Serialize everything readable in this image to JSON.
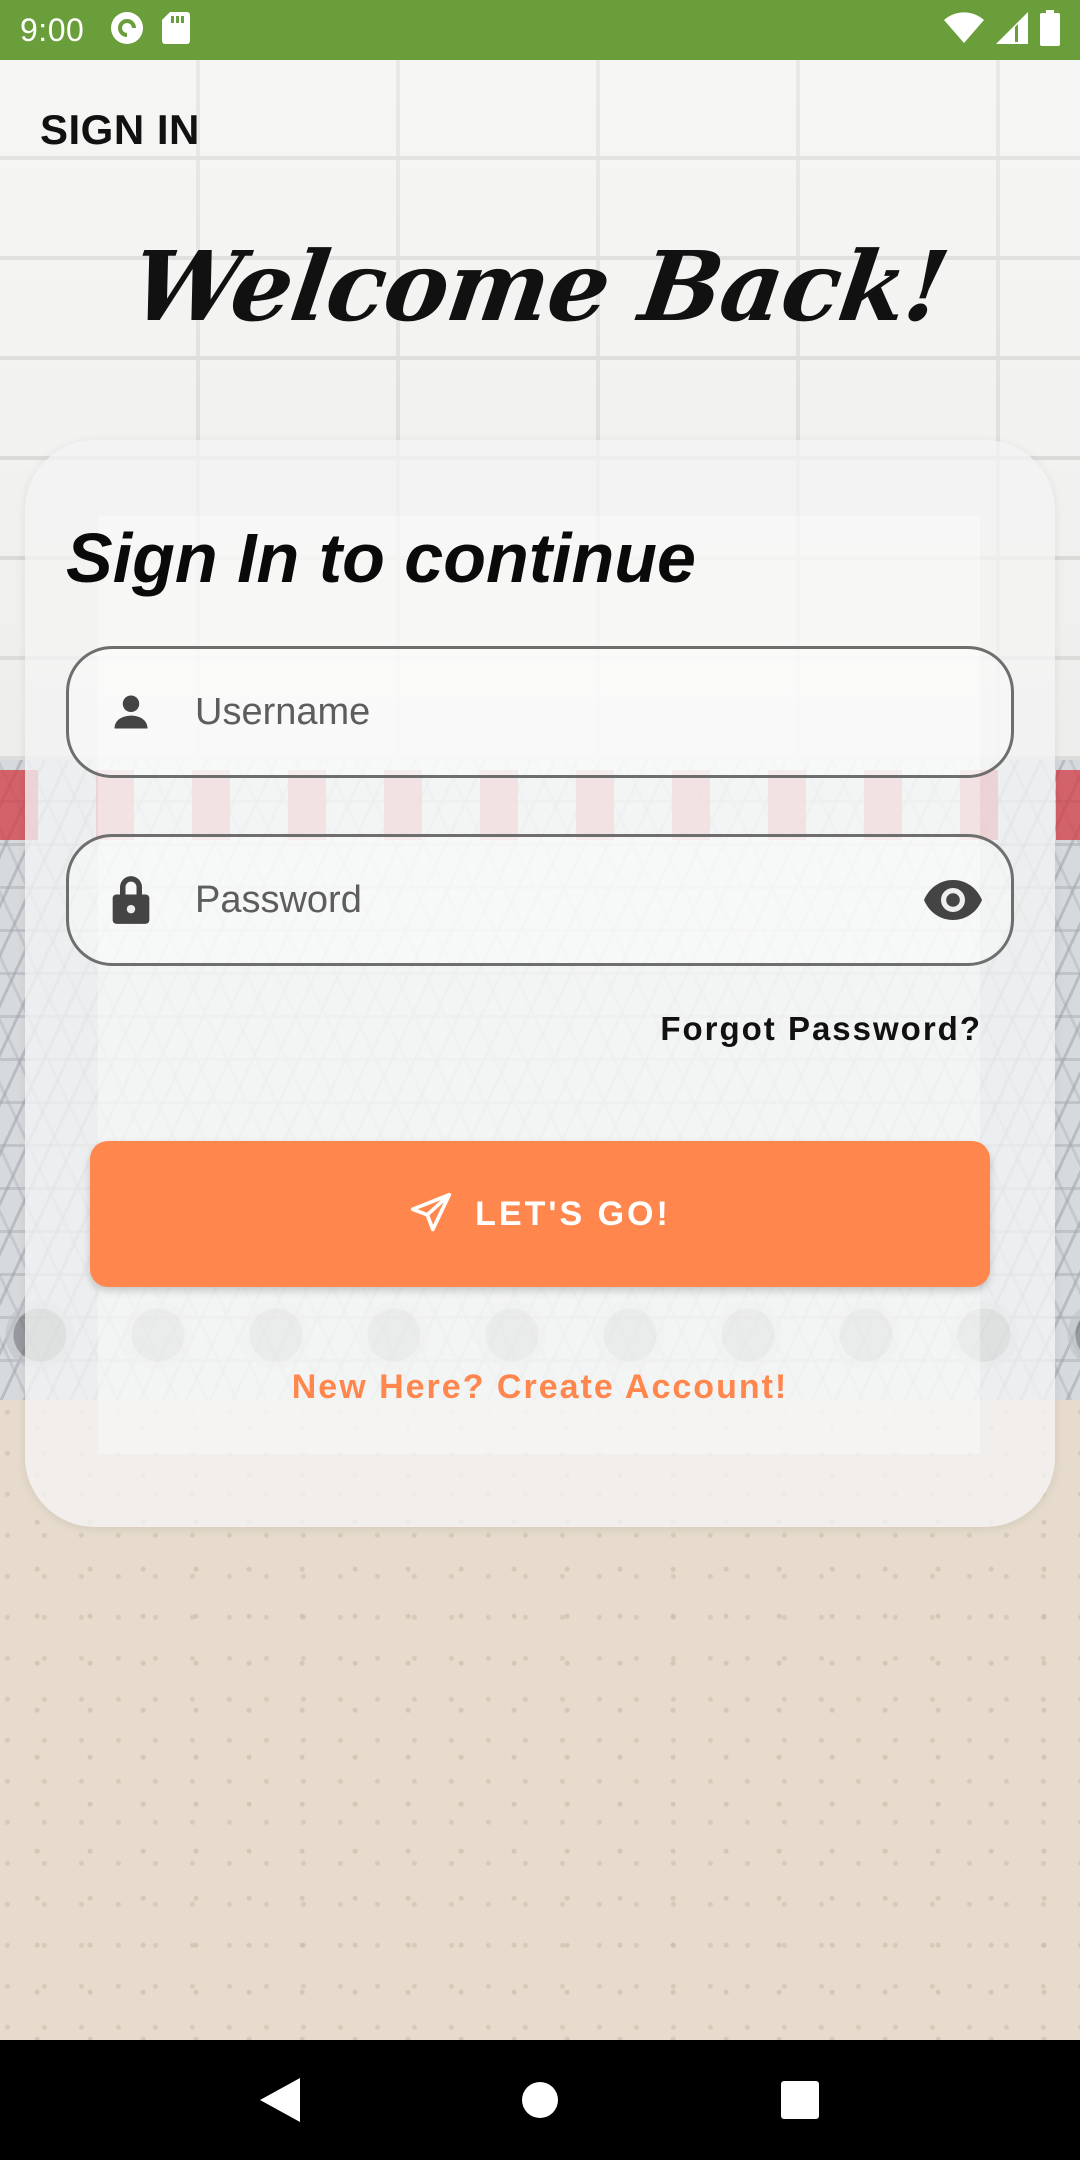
{
  "status_bar": {
    "time": "9:00",
    "icons_left": [
      "pocket-casts-icon",
      "sd-card-icon"
    ],
    "icons_right": [
      "wifi-icon",
      "cell-signal-icon",
      "battery-icon"
    ]
  },
  "app_bar": {
    "title": "SIGN IN"
  },
  "welcome": {
    "text": "Welcome Back!"
  },
  "card": {
    "heading": "Sign In to continue",
    "username": {
      "placeholder": "Username",
      "value": "",
      "icon": "person-icon"
    },
    "password": {
      "placeholder": "Password",
      "value": "",
      "icon": "lock-icon",
      "toggle_icon": "eye-icon"
    },
    "forgot_password": "Forgot Password?",
    "submit": {
      "label": "LET'S GO!",
      "icon": "send-icon"
    },
    "create_account": "New Here? Create Account!"
  },
  "colors": {
    "status_bar": "#6a9e3a",
    "accent": "#ff874d",
    "text": "#111111"
  },
  "nav_bar": {
    "buttons": [
      "back-icon",
      "home-icon",
      "recents-icon"
    ]
  }
}
